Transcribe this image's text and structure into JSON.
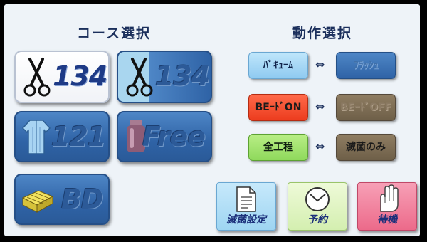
{
  "headings": {
    "course": "コース選択",
    "operation": "動作選択"
  },
  "courses": [
    {
      "label": "134",
      "icon": "scissors-icon",
      "state": "selected"
    },
    {
      "label": "134",
      "icon": "scissors-icon",
      "state": "split"
    },
    {
      "label": "121",
      "icon": "gown-icon",
      "state": "normal"
    },
    {
      "label": "Free",
      "icon": "container-icon",
      "state": "normal"
    },
    {
      "label": "BD",
      "icon": "package-icon",
      "state": "normal"
    }
  ],
  "operations": [
    {
      "left": "ﾊﾞｷｭｰﾑ",
      "right": "ﾌﾗｯｼｭ",
      "separator": "⇔"
    },
    {
      "left": "BEｰﾄﾞON",
      "right": "BEｰﾄﾞOFF",
      "separator": "⇔"
    },
    {
      "left": "全工程",
      "right": "滅菌のみ",
      "separator": "⇔"
    }
  ],
  "functions": [
    {
      "label": "滅菌設定",
      "icon": "document-icon"
    },
    {
      "label": "予約",
      "icon": "clock-icon"
    },
    {
      "label": "待機",
      "icon": "hand-icon"
    }
  ],
  "colors": {
    "panel": "#eef3f8",
    "button_blue": "#2f63a6",
    "button_red": "#ec3c1e",
    "button_green": "#8fd95c",
    "button_lightblue": "#8fcaf0",
    "button_brown": "#6e5f48",
    "func_pink": "#f06c8c"
  }
}
